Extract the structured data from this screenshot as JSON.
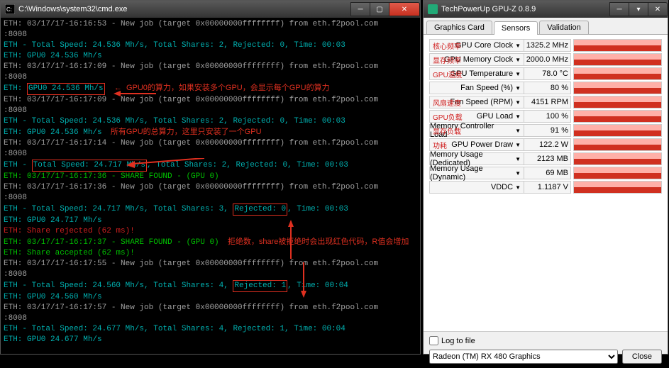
{
  "cmd": {
    "title": "C:\\Windows\\system32\\cmd.exe",
    "lines": [
      {
        "c": "gray",
        "t": "ETH: 03/17/17-16:16:53 - New job (target 0x00000000ffffffff) from eth.f2pool.com"
      },
      {
        "c": "gray",
        "t": ":8008"
      },
      {
        "c": "teal",
        "t": "ETH - Total Speed: 24.536 Mh/s, Total Shares: 2, Rejected: 0, Time: 00:03"
      },
      {
        "c": "teal",
        "t": "ETH: GPU0 24.536 Mh/s"
      },
      {
        "c": "gray",
        "t": "ETH: 03/17/17-16:17:09 - New job (target 0x00000000ffffffff) from eth.f2pool.com"
      },
      {
        "c": "gray",
        "t": ":8008"
      },
      {
        "box": "gpu0",
        "ann": "GPU0的算力，如果安装多个GPU，会显示每个GPU的算力"
      },
      {
        "c": "gray",
        "t": "ETH: 03/17/17-16:17:09 - New job (target 0x00000000ffffffff) from eth.f2pool.com"
      },
      {
        "c": "gray",
        "t": ":8008"
      },
      {
        "c": "teal",
        "t": "ETH - Total Speed: 24.536 Mh/s, Total Shares: 2, Rejected: 0, Time: 00:03"
      },
      {
        "c": "teal",
        "t": "ETH: GPU0 24.536 Mh/s",
        "postAnn": "所有GPU的总算力，这里只安装了一个GPU"
      },
      {
        "c": "gray",
        "t": "ETH: 03/17/17-16:17:14 - New job (target 0x00000000ffffffff) from eth.f2pool.com"
      },
      {
        "c": "gray",
        "t": ":8008"
      },
      {
        "box": "total"
      },
      {
        "c": "green",
        "t": "ETH: 03/17/17-16:17:36 - SHARE FOUND - (GPU 0)"
      },
      {
        "c": "gray",
        "t": "ETH: 03/17/17-16:17:36 - New job (target 0x00000000ffffffff) from eth.f2pool.com"
      },
      {
        "c": "gray",
        "t": ":8008"
      },
      {
        "box": "rej0"
      },
      {
        "c": "teal",
        "t": "ETH: GPU0 24.717 Mh/s"
      },
      {
        "c": "red",
        "t": "ETH: Share rejected (62 ms)!"
      },
      {
        "c": "green",
        "t": "ETH: 03/17/17-16:17:37 - SHARE FOUND - (GPU 0)",
        "postAnn": "拒绝数，share被拒绝时会出现红色代码，R值会增加"
      },
      {
        "c": "green",
        "t": "ETH: Share accepted (62 ms)!"
      },
      {
        "c": "gray",
        "t": "ETH: 03/17/17-16:17:55 - New job (target 0x00000000ffffffff) from eth.f2pool.com"
      },
      {
        "c": "gray",
        "t": ":8008"
      },
      {
        "box": "rej1"
      },
      {
        "c": "teal",
        "t": "ETH: GPU0 24.560 Mh/s"
      },
      {
        "c": "gray",
        "t": "ETH: 03/17/17-16:17:57 - New job (target 0x00000000ffffffff) from eth.f2pool.com"
      },
      {
        "c": "gray",
        "t": ":8008"
      },
      {
        "c": "teal",
        "t": "ETH - Total Speed: 24.677 Mh/s, Total Shares: 4, Rejected: 1, Time: 00:04"
      },
      {
        "c": "teal",
        "t": "ETH: GPU0 24.677 Mh/s"
      }
    ],
    "boxes": {
      "gpu0": {
        "pre": "ETH: ",
        "hl": "GPU0 24.536 Mh/s"
      },
      "total": {
        "pre": "ETH - ",
        "hl": "Total Speed: 24.717 Mh/s",
        "post": ", Total Shares: 2, Rejected: 0, Time: 00:03"
      },
      "rej0": {
        "pre": "ETH - Total Speed: 24.717 Mh/s, Total Shares: 3, ",
        "hl": "Rejected: 0",
        "post": ", Time: 00:03"
      },
      "rej1": {
        "pre": "ETH - Total Speed: 24.560 Mh/s, Total Shares: 4, ",
        "hl": "Rejected: 1",
        "post": ", Time: 00:04"
      }
    }
  },
  "gpuz": {
    "title": "TechPowerUp GPU-Z 0.8.9",
    "tabs": [
      "Graphics Card",
      "Sensors",
      "Validation"
    ],
    "activeTab": 1,
    "sensors": [
      {
        "label": "GPU Core Clock",
        "cn": "核心频率",
        "val": "1325.2 MHz"
      },
      {
        "label": "GPU Memory Clock",
        "cn": "显存频率",
        "val": "2000.0 MHz"
      },
      {
        "label": "GPU Temperature",
        "cn": "GPU温度",
        "val": "78.0 °C"
      },
      {
        "label": "Fan Speed (%)",
        "cn": "",
        "val": "80 %"
      },
      {
        "label": "Fan Speed (RPM)",
        "cn": "风扇速度",
        "val": "4151 RPM"
      },
      {
        "label": "GPU Load",
        "cn": "GPU负载",
        "val": "100 %"
      },
      {
        "label": "Memory Controller Load",
        "cn": "显存负载",
        "val": "91 %"
      },
      {
        "label": "GPU Power Draw",
        "cn": "功耗",
        "val": "122.2 W"
      },
      {
        "label": "Memory Usage (Dedicated)",
        "cn": "",
        "val": "2123 MB"
      },
      {
        "label": "Memory Usage (Dynamic)",
        "cn": "",
        "val": "69 MB"
      },
      {
        "label": "VDDC",
        "cn": "",
        "val": "1.1187 V"
      }
    ],
    "logLabel": "Log to file",
    "card": "Radeon (TM) RX 480 Graphics",
    "closeBtn": "Close"
  }
}
